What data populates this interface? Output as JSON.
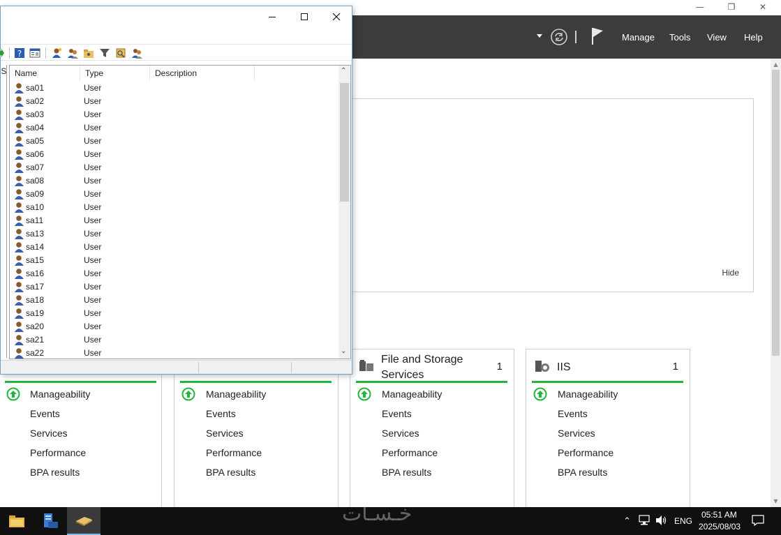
{
  "server_manager": {
    "menu": {
      "manage": "Manage",
      "tools": "Tools",
      "view": "View",
      "help": "Help"
    },
    "welcome": {
      "hide_label": "Hide"
    },
    "tiles": [
      {
        "title": "",
        "count": "",
        "rows": [
          "Manageability",
          "Events",
          "Services",
          "Performance",
          "BPA results"
        ]
      },
      {
        "title": "",
        "count": "",
        "rows": [
          "Manageability",
          "Events",
          "Services",
          "Performance",
          "BPA results"
        ]
      },
      {
        "title": "File and Storage Services",
        "count": "1",
        "rows": [
          "Manageability",
          "Events",
          "Services",
          "Performance",
          "BPA results"
        ]
      },
      {
        "title": "IIS",
        "count": "1",
        "rows": [
          "Manageability",
          "Events",
          "Services",
          "Performance",
          "BPA results"
        ]
      }
    ]
  },
  "ad_window": {
    "left_pane_stub": ".S",
    "columns": {
      "name": "Name",
      "type": "Type",
      "description": "Description"
    },
    "users": [
      {
        "name": "sa01",
        "type": "User"
      },
      {
        "name": "sa02",
        "type": "User"
      },
      {
        "name": "sa03",
        "type": "User"
      },
      {
        "name": "sa04",
        "type": "User"
      },
      {
        "name": "sa05",
        "type": "User"
      },
      {
        "name": "sa06",
        "type": "User"
      },
      {
        "name": "sa07",
        "type": "User"
      },
      {
        "name": "sa08",
        "type": "User"
      },
      {
        "name": "sa09",
        "type": "User"
      },
      {
        "name": "sa10",
        "type": "User"
      },
      {
        "name": "sa11",
        "type": "User"
      },
      {
        "name": "sa13",
        "type": "User"
      },
      {
        "name": "sa14",
        "type": "User"
      },
      {
        "name": "sa15",
        "type": "User"
      },
      {
        "name": "sa16",
        "type": "User"
      },
      {
        "name": "sa17",
        "type": "User"
      },
      {
        "name": "sa18",
        "type": "User"
      },
      {
        "name": "sa19",
        "type": "User"
      },
      {
        "name": "sa20",
        "type": "User"
      },
      {
        "name": "sa21",
        "type": "User"
      },
      {
        "name": "sa22",
        "type": "User"
      }
    ]
  },
  "taskbar": {
    "language": "ENG",
    "time": "05:51 AM",
    "date": "2025/08/03",
    "watermark": "خـسـات"
  },
  "colors": {
    "accent_green": "#1fb63b",
    "header_dark": "#3c3c3c",
    "taskbar": "#101010"
  }
}
